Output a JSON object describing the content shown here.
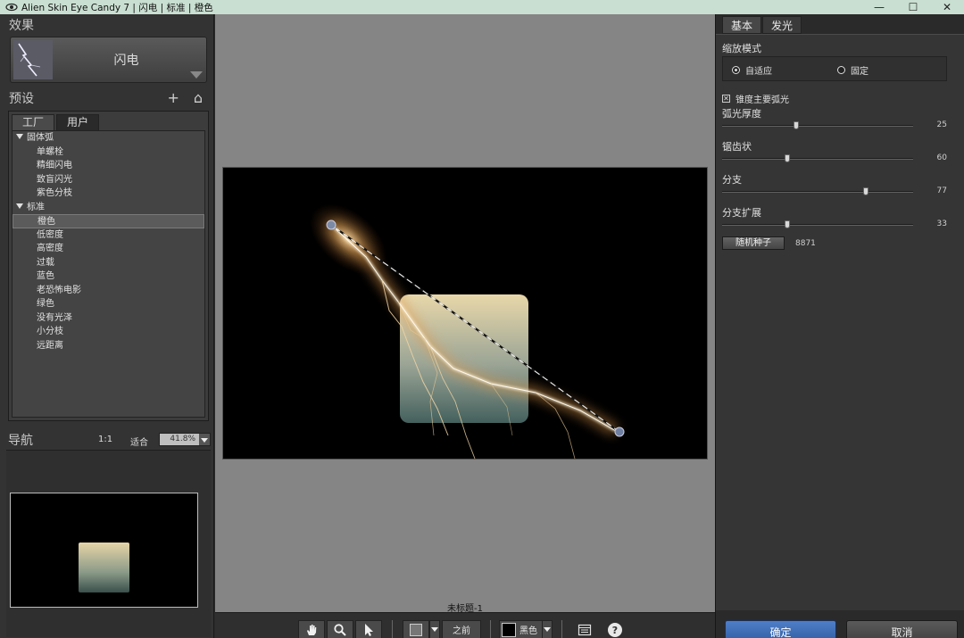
{
  "window": {
    "title": "Alien Skin Eye Candy 7 | 闪电 | 标准 | 橙色",
    "minimize": "—",
    "maximize": "☐",
    "close": "✕"
  },
  "left": {
    "effects_heading": "效果",
    "effect_name": "闪电",
    "presets_heading": "预设",
    "add_icon": "+",
    "home_icon": "⌂",
    "tabs": [
      "工厂",
      "用户"
    ],
    "tree": [
      {
        "type": "group",
        "label": "固体弧"
      },
      {
        "type": "item",
        "label": "单螺栓"
      },
      {
        "type": "item",
        "label": "精细闪电"
      },
      {
        "type": "item",
        "label": "致盲闪光"
      },
      {
        "type": "item",
        "label": "紫色分枝"
      },
      {
        "type": "group",
        "label": "标准"
      },
      {
        "type": "item",
        "label": "橙色",
        "selected": true
      },
      {
        "type": "item",
        "label": "低密度"
      },
      {
        "type": "item",
        "label": "高密度"
      },
      {
        "type": "item",
        "label": "过载"
      },
      {
        "type": "item",
        "label": "蓝色"
      },
      {
        "type": "item",
        "label": "老恐怖电影"
      },
      {
        "type": "item",
        "label": "绿色"
      },
      {
        "type": "item",
        "label": "没有光泽"
      },
      {
        "type": "item",
        "label": "小分枝"
      },
      {
        "type": "item",
        "label": "远距离"
      }
    ],
    "navigation": {
      "heading": "导航",
      "one_to_one": "1:1",
      "fit": "适合",
      "zoom": "41.8%"
    }
  },
  "canvas": {
    "document_title": "未标题-1"
  },
  "toolbar": {
    "before_label": "之前",
    "bg_label": "黑色"
  },
  "right": {
    "tabs": [
      "基本",
      "发光"
    ],
    "scale_mode_label": "缩放模式",
    "radio_adaptive": "自适应",
    "radio_fixed": "固定",
    "taper_label": "锥度主要弧光",
    "sliders": [
      {
        "label": "弧光厚度",
        "value": "25",
        "level": 0.39
      },
      {
        "label": "锯齿状",
        "value": "60",
        "level": 0.34
      },
      {
        "label": "分支",
        "value": "77",
        "level": 0.75
      },
      {
        "label": "分支扩展",
        "value": "33",
        "level": 0.34
      }
    ],
    "seed_button": "随机种子",
    "seed_value": "8871",
    "ok": "确定",
    "cancel": "取消"
  },
  "colors": {
    "titlebar": "#c9dfd1",
    "panel": "#333333",
    "canvas_bg": "#858585",
    "ok_button": "#3f6db5"
  }
}
